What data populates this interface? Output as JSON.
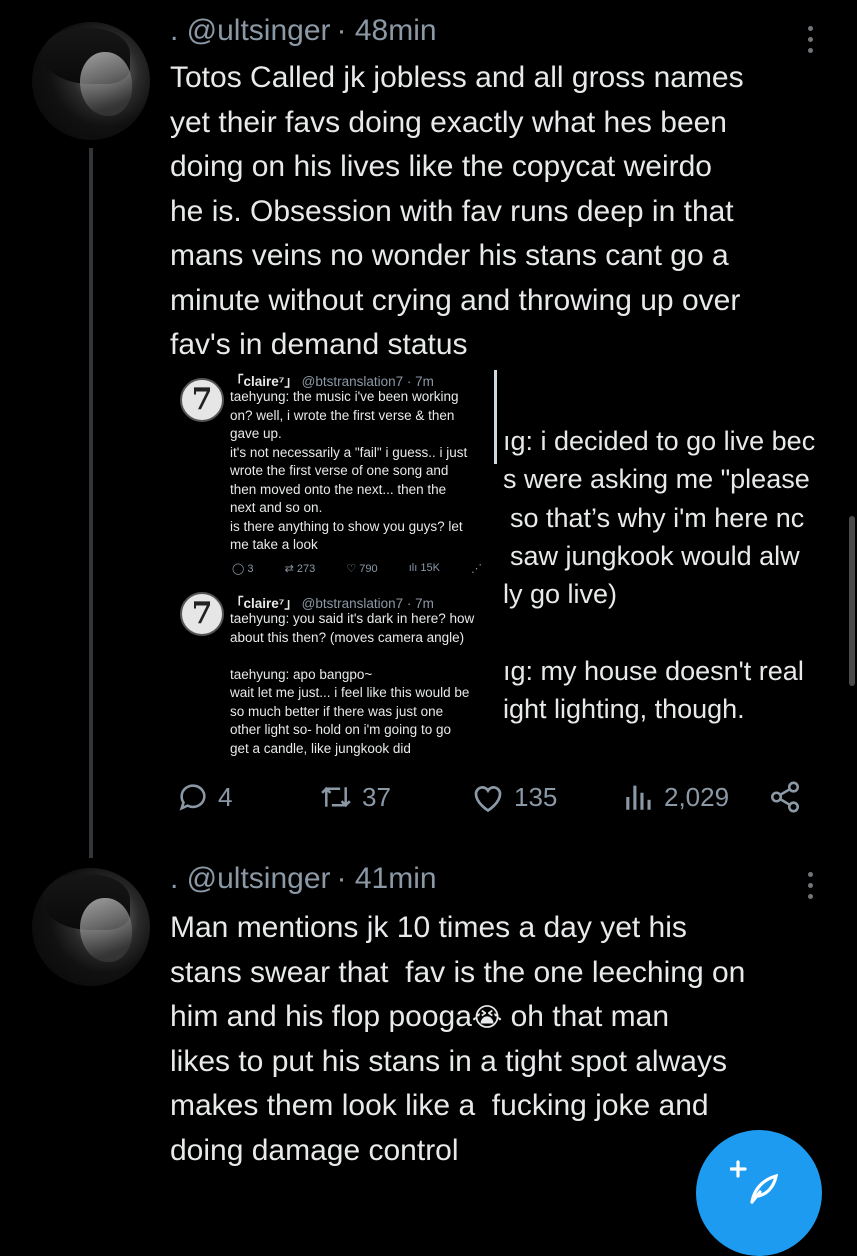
{
  "tweets": [
    {
      "handle": ". @ultsinger",
      "time": "· 48min",
      "text": "Totos Called jk jobless and all gross names\nyet their favs doing exactly what hes been\ndoing on his lives like the copycat weirdo\nhe is. Obsession with fav runs deep in that\nmans veins no wonder his stans cant go a\nminute without crying and throwing up over\nfav's in demand status",
      "actions": {
        "replies": "4",
        "reposts": "37",
        "likes": "135",
        "views": "2,029"
      }
    },
    {
      "handle": ". @ultsinger",
      "time": "· 41min",
      "text": "Man mentions jk 10 times a day yet his\nstans swear that  fav is the one leeching on\nhim and his flop pooga",
      "text_tail": " oh that man",
      "text_rest": "likes to put his stans in a tight spot always\nmakes them look like a  fucking joke and\ndoing damage control",
      "emoji": "😭"
    }
  ],
  "embedded": {
    "left_posts": [
      {
        "author": "「claire⁷」",
        "meta": "@btstranslation7 · 7m",
        "text": "taehyung: the music i've been working\non? well, i wrote the first verse & then\ngave up.\nit's not necessarily a \"fail\" i guess.. i just\nwrote the first verse of one song and\nthen moved onto the next... then the\nnext and so on.\nis there anything to show you guys? let\nme take a look",
        "actions": {
          "replies": "3",
          "reposts": "273",
          "likes": "790",
          "views": "15K"
        }
      },
      {
        "author": "「claire⁷」",
        "meta": "@btstranslation7 · 7m",
        "text": "taehyung: you said it's dark in here? how\nabout this then? (moves camera angle)\n\ntaehyung: apo bangpo~\nwait let me just... i feel like this would be\nso much better if there was just one\nother light so- hold on i'm going to go\nget a candle, like jungkook did"
      }
    ],
    "right_lines": [
      "ıg: i decided to go live bec",
      "s were asking me \"please",
      "so that’s why i'm here nc",
      "saw jungkook would alw",
      "ly go live)",
      "ıg: my house doesn't real",
      "ight lighting, though."
    ]
  },
  "icons": {
    "reply": "reply-icon",
    "repost": "repost-icon",
    "like": "heart-icon",
    "views": "views-icon",
    "share": "share-icon",
    "compose": "compose-feather-icon"
  },
  "colors": {
    "accent": "#1d9bf0",
    "muted": "#8b98a5",
    "text": "#e7e9ea",
    "background": "#000000"
  }
}
